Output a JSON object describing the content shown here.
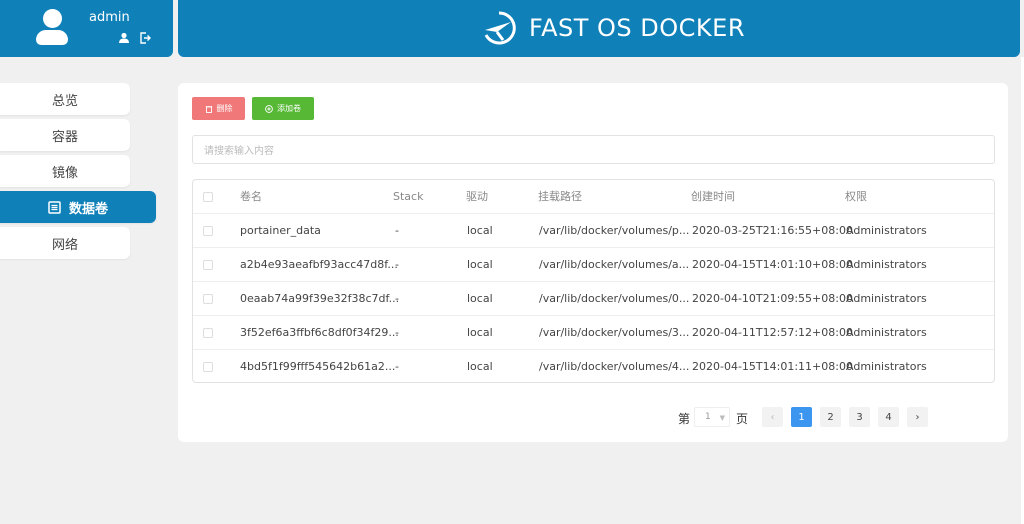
{
  "user": {
    "name": "admin",
    "profile_icon": "user-icon",
    "logout_icon": "logout-icon"
  },
  "header": {
    "title": "FAST OS DOCKER",
    "logo_icon": "compass-logo-icon"
  },
  "sidebar": {
    "items": [
      {
        "label": "总览",
        "active": false
      },
      {
        "label": "容器",
        "active": false
      },
      {
        "label": "镜像",
        "active": false
      },
      {
        "label": "数据卷",
        "active": true,
        "icon": "list-icon"
      },
      {
        "label": "网络",
        "active": false
      }
    ]
  },
  "toolbar": {
    "delete_label": "删除",
    "add_label": "添加卷"
  },
  "search": {
    "placeholder": "请搜索输入内容"
  },
  "table": {
    "columns": [
      "卷名",
      "Stack",
      "驱动",
      "挂载路径",
      "创建时间",
      "权限"
    ],
    "rows": [
      [
        "portainer_data",
        "-",
        "local",
        "/var/lib/docker/volumes/p...",
        "2020-03-25T21:16:55+08:00",
        "Administrators"
      ],
      [
        "a2b4e93aeafbf93acc47d8f...",
        "-",
        "local",
        "/var/lib/docker/volumes/a...",
        "2020-04-15T14:01:10+08:00",
        "Administrators"
      ],
      [
        "0eaab74a99f39e32f38c7df...",
        "-",
        "local",
        "/var/lib/docker/volumes/0...",
        "2020-04-10T21:09:55+08:00",
        "Administrators"
      ],
      [
        "3f52ef6a3ffbf6c8df0f34f29...",
        "-",
        "local",
        "/var/lib/docker/volumes/3...",
        "2020-04-11T12:57:12+08:00",
        "Administrators"
      ],
      [
        "4bd5f1f99fff545642b61a2...",
        "-",
        "local",
        "/var/lib/docker/volumes/4...",
        "2020-04-15T14:01:11+08:00",
        "Administrators"
      ]
    ]
  },
  "pagination": {
    "prefix": "第",
    "current_select": "1",
    "suffix": "页",
    "prev": "‹",
    "pages": [
      "1",
      "2",
      "3",
      "4"
    ],
    "current_page": "1",
    "next": "›"
  },
  "colors": {
    "primary": "#0f80b8",
    "danger": "#f07878",
    "success": "#56b835",
    "page_active": "#3c96f0"
  }
}
